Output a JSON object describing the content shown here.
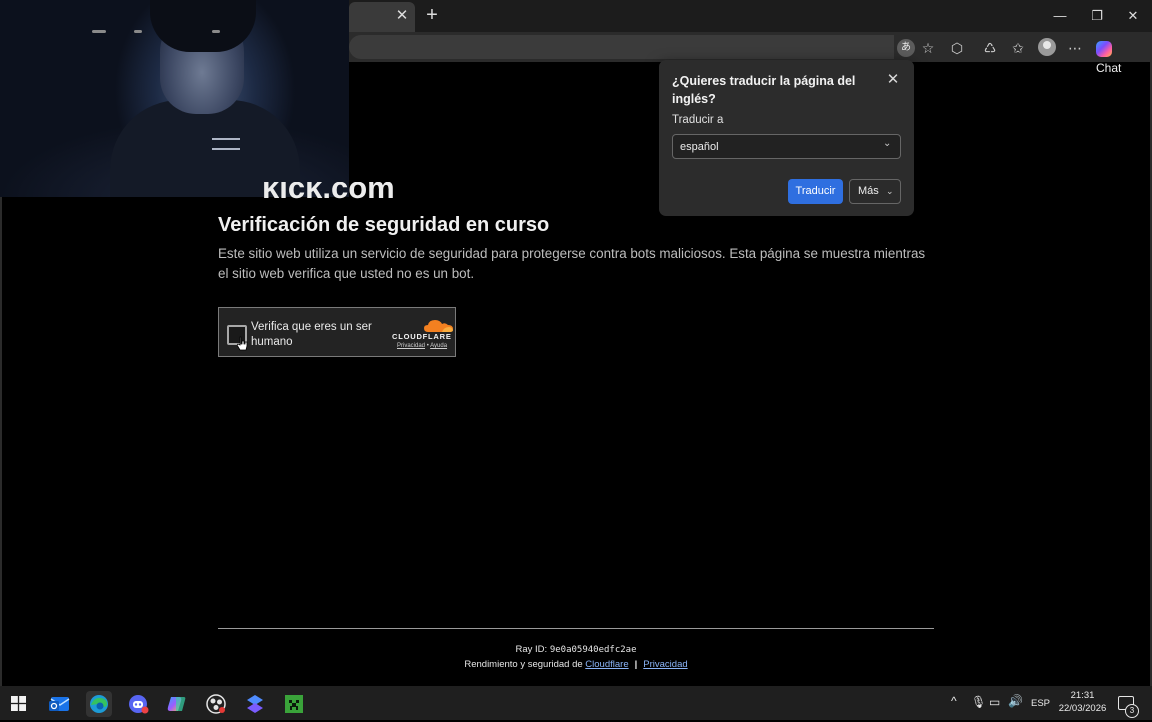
{
  "browser": {
    "tab_close": "✕",
    "new_tab": "+",
    "window_controls": {
      "minimize": "—",
      "restore": "❐",
      "close": "✕"
    },
    "toolbar_icons": [
      "translate-icon",
      "favorite-star-icon",
      "extensions-icon",
      "collections-icon",
      "favorites-icon",
      "profile-avatar-icon",
      "more-icon"
    ],
    "copilot_label": "Chat"
  },
  "page": {
    "site_name_partial": "kick.com",
    "heading": "Verificación de seguridad en curso",
    "description": "Este sitio web utiliza un servicio de seguridad para protegerse contra bots maliciosos. Esta página se muestra mientras el sitio web verifica que usted no es un bot.",
    "turnstile": {
      "label": "Verifica que eres un ser humano",
      "brand": "CLOUDFLARE",
      "privacy": "Privacidad",
      "dot": "•",
      "help": "Ayuda"
    },
    "footer": {
      "ray_label": "Ray ID:",
      "ray_id": "9e0a05940edfc2ae",
      "perf_prefix": "Rendimiento y seguridad de",
      "cloudflare_link": "Cloudflare",
      "separator": "|",
      "privacy_link": "Privacidad"
    }
  },
  "translate_popup": {
    "title": "¿Quieres traducir la página del inglés?",
    "label": "Traducir a",
    "selected_language": "español",
    "translate_button": "Traducir",
    "more_button": "Más",
    "close": "✕"
  },
  "taskbar": {
    "apps": [
      "windows-start-icon",
      "outlook-icon",
      "edge-icon",
      "discord-icon",
      "copilot-icon",
      "obs-icon",
      "tool-icon",
      "minecraft-icon"
    ],
    "tray": {
      "chevron": "^",
      "language": "ESP",
      "notifications_count": "3"
    },
    "time": "21:31",
    "date": "22/03/2026"
  },
  "colors": {
    "accent": "#2f6fe0",
    "link": "#8ab4f8",
    "cloudflare_orange": "#f38020"
  }
}
